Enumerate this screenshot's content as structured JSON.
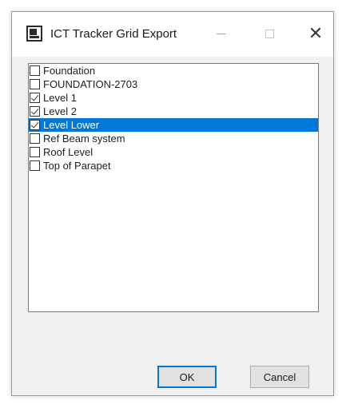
{
  "window": {
    "title": "ICT Tracker Grid Export",
    "icon": "app-icon",
    "controls": {
      "minimize": "minimize-icon",
      "maximize": "maximize-icon",
      "close_glyph": "✕"
    }
  },
  "list": {
    "items": [
      {
        "label": "Foundation",
        "checked": false,
        "selected": false
      },
      {
        "label": "FOUNDATION-2703",
        "checked": false,
        "selected": false
      },
      {
        "label": "Level 1",
        "checked": true,
        "selected": false
      },
      {
        "label": "Level 2",
        "checked": true,
        "selected": false
      },
      {
        "label": "Level Lower",
        "checked": true,
        "selected": true
      },
      {
        "label": "Ref Beam system",
        "checked": false,
        "selected": false
      },
      {
        "label": "Roof Level",
        "checked": false,
        "selected": false
      },
      {
        "label": "Top of Parapet",
        "checked": false,
        "selected": false
      }
    ],
    "selection_color": "#0078d7"
  },
  "buttons": {
    "ok": "OK",
    "cancel": "Cancel"
  }
}
